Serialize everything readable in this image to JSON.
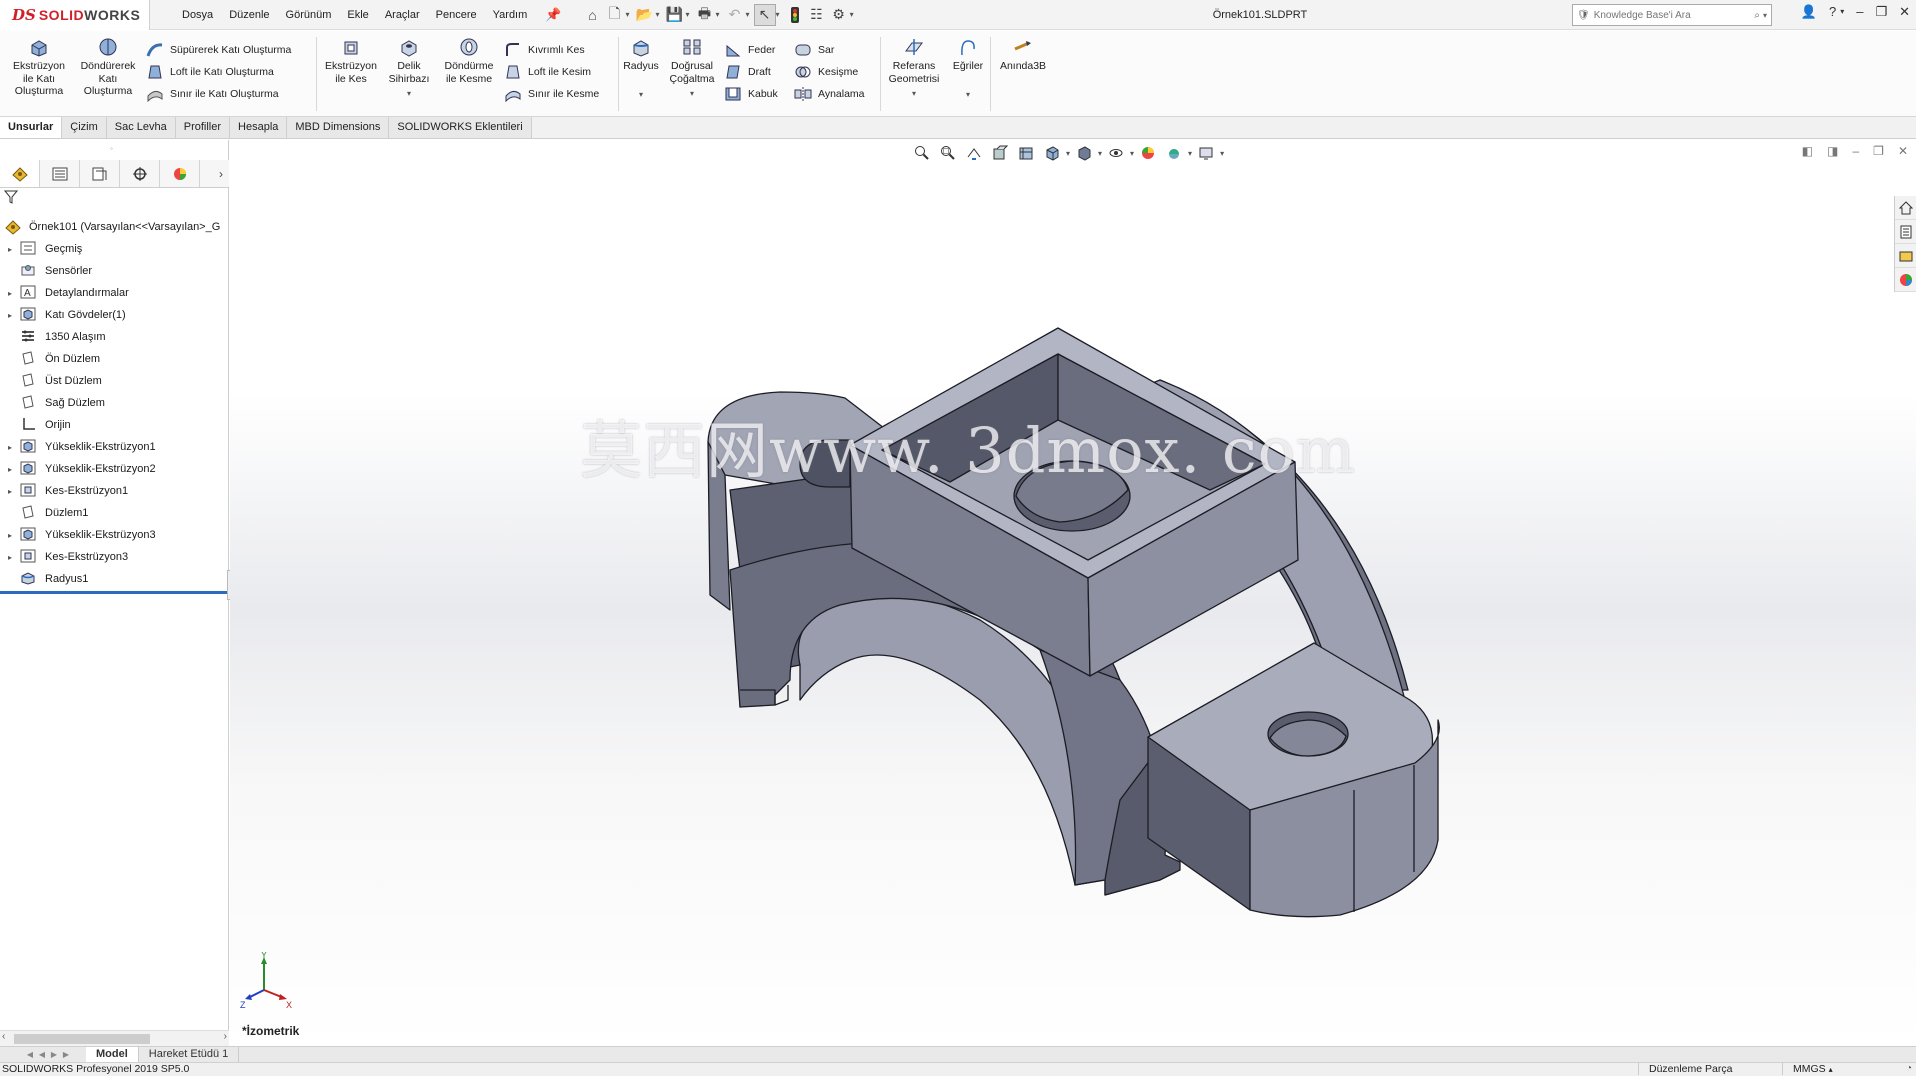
{
  "app": {
    "logo_prefix": "DS",
    "logo_text_a": "SOLID",
    "logo_text_b": "WORKS",
    "document_title": "Örnek101.SLDPRT"
  },
  "menu": [
    "Dosya",
    "Düzenle",
    "Görünüm",
    "Ekle",
    "Araçlar",
    "Pencere",
    "Yardım"
  ],
  "search": {
    "placeholder": "Knowledge Base'i Ara"
  },
  "commands": {
    "extrude_boss": "Ekstrüzyon\nile Katı\nOluşturma",
    "revolve_boss": "Döndürerek\nKatı\nOluşturma",
    "sweep_boss": "Süpürerek Katı Oluşturma",
    "loft_boss": "Loft ile Katı Oluşturma",
    "boundary_boss": "Sınır ile Katı Oluşturma",
    "extrude_cut": "Ekstrüzyon\nile Kes",
    "hole_wizard": "Delik\nSihirbazı",
    "revolve_cut": "Döndürme\nile Kesme",
    "swept_cut": "Kıvrımlı Kes",
    "loft_cut": "Loft ile Kesim",
    "boundary_cut": "Sınır ile Kesme",
    "fillet": "Radyus",
    "linear_pattern": "Doğrusal\nÇoğaltma",
    "rib": "Feder",
    "draft": "Draft",
    "shell": "Kabuk",
    "wrap": "Sar",
    "intersect": "Kesişme",
    "mirror": "Aynalama",
    "ref_geometry": "Referans\nGeometrisi",
    "curves": "Eğriler",
    "instant3d": "Anında3B"
  },
  "tabs": [
    "Unsurlar",
    "Çizim",
    "Sac Levha",
    "Profiller",
    "Hesapla",
    "MBD Dimensions",
    "SOLIDWORKS Eklentileri"
  ],
  "tree": {
    "root": "Örnek101  (Varsayılan<<Varsayılan>_G",
    "items": [
      {
        "label": "Geçmiş",
        "expandable": true,
        "icon": "history-icon"
      },
      {
        "label": "Sensörler",
        "expandable": false,
        "icon": "sensor-icon"
      },
      {
        "label": "Detaylandırmalar",
        "expandable": true,
        "icon": "annotation-icon"
      },
      {
        "label": "Katı Gövdeler(1)",
        "expandable": true,
        "icon": "solid-bodies-icon"
      },
      {
        "label": "1350 Alaşım",
        "expandable": false,
        "icon": "material-icon"
      },
      {
        "label": "Ön Düzlem",
        "expandable": false,
        "icon": "plane-icon"
      },
      {
        "label": "Üst Düzlem",
        "expandable": false,
        "icon": "plane-icon"
      },
      {
        "label": "Sağ Düzlem",
        "expandable": false,
        "icon": "plane-icon"
      },
      {
        "label": "Orijin",
        "expandable": false,
        "icon": "origin-icon"
      },
      {
        "label": "Yükseklik-Ekstrüzyon1",
        "expandable": true,
        "icon": "boss-extrude-icon"
      },
      {
        "label": "Yükseklik-Ekstrüzyon2",
        "expandable": true,
        "icon": "boss-extrude-icon"
      },
      {
        "label": "Kes-Ekstrüzyon1",
        "expandable": true,
        "icon": "cut-extrude-icon"
      },
      {
        "label": "Düzlem1",
        "expandable": false,
        "icon": "plane-icon"
      },
      {
        "label": "Yükseklik-Ekstrüzyon3",
        "expandable": true,
        "icon": "boss-extrude-icon"
      },
      {
        "label": "Kes-Ekstrüzyon3",
        "expandable": true,
        "icon": "cut-extrude-icon"
      },
      {
        "label": "Radyus1",
        "expandable": false,
        "icon": "fillet-icon"
      }
    ]
  },
  "viewport": {
    "watermark": "莫西网www. 3dmox. com",
    "view_name": "*İzometrik",
    "triad": {
      "x": "X",
      "y": "Y",
      "z": "Z"
    }
  },
  "bottom_tabs": [
    "Model",
    "Hareket Etüdü 1"
  ],
  "status": {
    "product": "SOLIDWORKS Profesyonel 2019 SP5.0",
    "mode": "Düzenleme Parça",
    "units": "MMGS"
  },
  "colors": {
    "brand_red": "#d0202a",
    "part_light": "#a6a9b8",
    "part_mid": "#8d90a0",
    "part_dark": "#5d6070",
    "selection_blue": "#2a6cc0"
  }
}
